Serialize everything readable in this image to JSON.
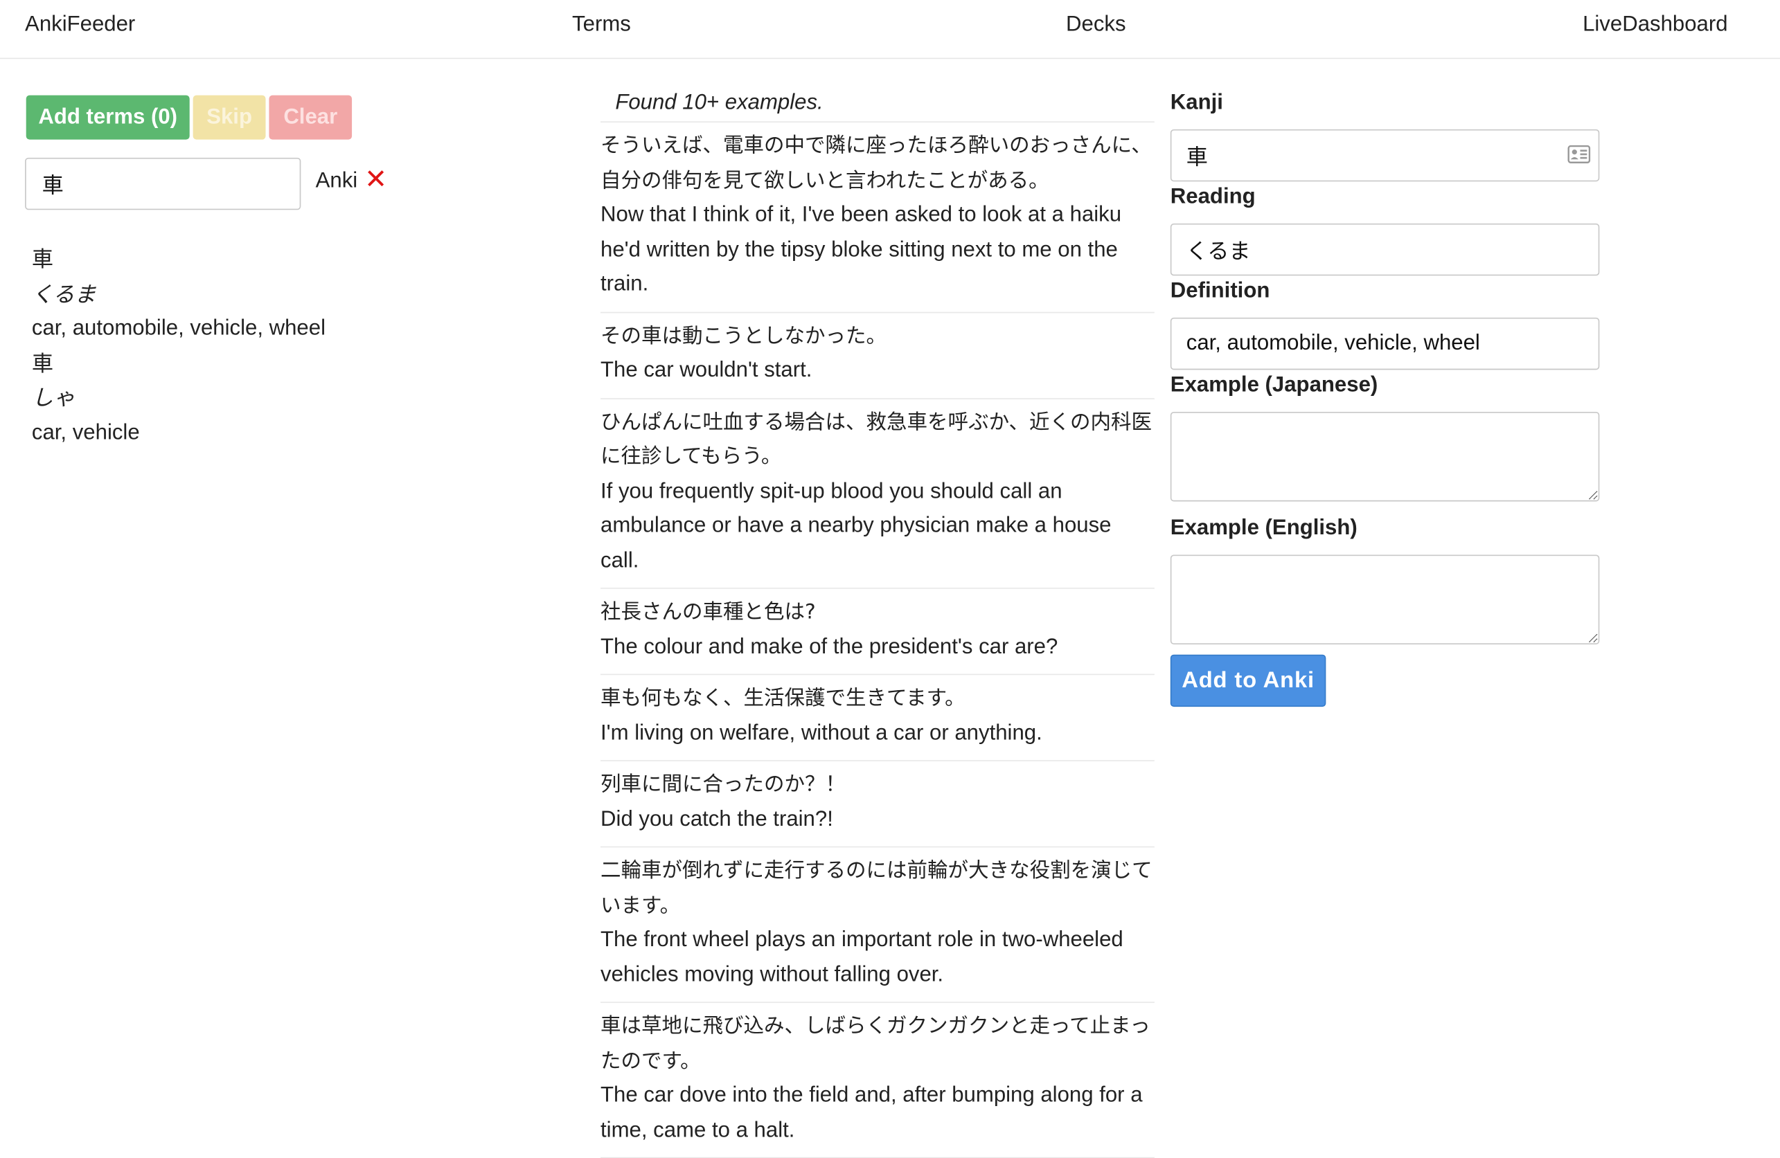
{
  "nav": {
    "brand": "AnkiFeeder",
    "terms": "Terms",
    "decks": "Decks",
    "dashboard": "LiveDashboard"
  },
  "toolbar": {
    "add_terms_label": "Add terms (0)",
    "skip_label": "Skip",
    "clear_label": "Clear"
  },
  "search": {
    "value": "車",
    "anki_label": "Anki",
    "anki_status_icon": "close-x-icon",
    "anki_status_color": "#e01515"
  },
  "dictionary_results": [
    {
      "kanji": "車",
      "reading": "くるま",
      "definition": "car, automobile, vehicle, wheel"
    },
    {
      "kanji": "車",
      "reading": "しゃ",
      "definition": "car, vehicle"
    }
  ],
  "examples": {
    "found_text": "Found 10+ examples.",
    "items": [
      {
        "jp": "そういえば、電車の中で隣に座ったほろ酔いのおっさんに、自分の俳句を見て欲しいと言われたことがある。",
        "en": "Now that I think of it, I've been asked to look at a haiku he'd written by the tipsy bloke sitting next to me on the train."
      },
      {
        "jp": "その車は動こうとしなかった。",
        "en": "The car wouldn't start."
      },
      {
        "jp": "ひんぱんに吐血する場合は、救急車を呼ぶか、近くの内科医に往診してもらう。",
        "en": "If you frequently spit-up blood you should call an ambulance or have a nearby physician make a house call."
      },
      {
        "jp": "社長さんの車種と色は?",
        "en": "The colour and make of the president's car are?"
      },
      {
        "jp": "車も何もなく、生活保護で生きてます。",
        "en": "I'm living on welfare, without a car or anything."
      },
      {
        "jp": "列車に間に合ったのか？！",
        "en": "Did you catch the train?!"
      },
      {
        "jp": "二輪車が倒れずに走行するのには前輪が大きな役割を演じています。",
        "en": "The front wheel plays an important role in two-wheeled vehicles moving without falling over."
      },
      {
        "jp": "車は草地に飛び込み、しばらくガクンガクンと走って止まったのです。",
        "en": "The car dove into the field and, after bumping along for a time, came to a halt."
      }
    ]
  },
  "card_form": {
    "kanji_label": "Kanji",
    "kanji_value": "車",
    "reading_label": "Reading",
    "reading_value": "くるま",
    "definition_label": "Definition",
    "definition_value": "car, automobile, vehicle, wheel",
    "example_jp_label": "Example (Japanese)",
    "example_jp_value": "",
    "example_en_label": "Example (English)",
    "example_en_value": "",
    "submit_label": "Add to Anki"
  },
  "colors": {
    "add_terms": "#5cb870",
    "skip": "#f2e3a6",
    "clear": "#f2a7a7",
    "add_to_anki": "#4a90e2"
  }
}
